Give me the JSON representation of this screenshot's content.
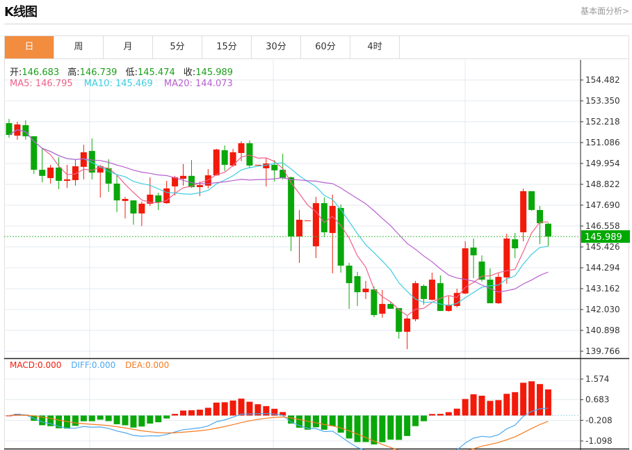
{
  "header": {
    "title": "K线图",
    "link": "基本面分析>"
  },
  "tabs": [
    {
      "label": "日",
      "active": true
    },
    {
      "label": "周"
    },
    {
      "label": "月"
    },
    {
      "label": "5分"
    },
    {
      "label": "15分"
    },
    {
      "label": "30分"
    },
    {
      "label": "60分"
    },
    {
      "label": "4时"
    }
  ],
  "ohlc": {
    "open_label": "开:",
    "open": "146.683",
    "high_label": "高:",
    "high": "146.739",
    "low_label": "低:",
    "low": "145.474",
    "close_label": "收:",
    "close": "145.989"
  },
  "ma": {
    "ma5": "MA5: 146.795",
    "ma10": "MA10: 145.469",
    "ma20": "MA20: 144.073"
  },
  "macd_info": {
    "macd": "MACD:0.000",
    "diff": "DIFF:0.000",
    "dea": "DEA:0.000"
  },
  "colors": {
    "up": "#f21a0a",
    "down": "#09a709",
    "ma5": "#f0608a",
    "ma10": "#3dcde0",
    "ma20": "#b75fcf",
    "diff": "#4aa8f0",
    "dea": "#f57a1f",
    "accent": "#f28c3f"
  },
  "chart_data": {
    "type": "candlestick",
    "price_ticks": [
      "154.482",
      "153.350",
      "152.218",
      "151.086",
      "149.954",
      "148.822",
      "147.690",
      "146.558",
      "145.426",
      "144.294",
      "143.162",
      "142.030",
      "140.898",
      "139.766"
    ],
    "price_range": [
      139.766,
      154.482
    ],
    "last_price": "145.989",
    "macd_ticks": [
      "1.574",
      "0.683",
      "-0.208",
      "-1.098"
    ],
    "macd_range": [
      -1.098,
      1.574
    ],
    "ohlc": [
      [
        152.14,
        152.37,
        151.35,
        151.5
      ],
      [
        151.46,
        152.22,
        151.24,
        152.07
      ],
      [
        152.03,
        152.29,
        151.24,
        151.43
      ],
      [
        151.43,
        151.43,
        149.39,
        149.61
      ],
      [
        149.61,
        150.78,
        148.93,
        149.28
      ],
      [
        149.16,
        149.88,
        148.86,
        149.73
      ],
      [
        149.73,
        150.29,
        148.56,
        149.01
      ],
      [
        149.01,
        149.88,
        148.63,
        149.09
      ],
      [
        149.05,
        150.18,
        148.75,
        149.8
      ],
      [
        149.77,
        150.97,
        149.09,
        150.56
      ],
      [
        150.63,
        151.31,
        149.09,
        149.46
      ],
      [
        149.46,
        149.88,
        148.1,
        149.8
      ],
      [
        149.69,
        150.18,
        148.41,
        148.86
      ],
      [
        148.86,
        149.35,
        147.31,
        147.95
      ],
      [
        147.92,
        148.14,
        146.97,
        148.03
      ],
      [
        147.95,
        147.95,
        146.63,
        147.24
      ],
      [
        147.24,
        147.88,
        146.56,
        147.77
      ],
      [
        147.77,
        149.2,
        147.65,
        148.26
      ],
      [
        148.22,
        148.37,
        147.43,
        147.84
      ],
      [
        147.8,
        149.01,
        147.77,
        148.6
      ],
      [
        148.71,
        149.28,
        148.22,
        149.2
      ],
      [
        149.12,
        149.92,
        148.75,
        149.28
      ],
      [
        149.28,
        150.14,
        148.63,
        148.67
      ],
      [
        148.67,
        148.97,
        148.18,
        148.78
      ],
      [
        148.75,
        149.65,
        148.6,
        149.31
      ],
      [
        149.31,
        150.75,
        149.28,
        150.71
      ],
      [
        150.67,
        150.93,
        149.54,
        149.88
      ],
      [
        149.84,
        150.75,
        149.77,
        150.56
      ],
      [
        150.52,
        151.16,
        150.07,
        151.05
      ],
      [
        151.05,
        151.2,
        149.69,
        149.84
      ],
      [
        149.84,
        149.88,
        149.84,
        149.88
      ],
      [
        149.69,
        150.26,
        148.71,
        149.95
      ],
      [
        149.88,
        150.14,
        148.97,
        149.58
      ],
      [
        149.61,
        150.48,
        149.09,
        149.16
      ],
      [
        149.2,
        149.24,
        145.2,
        145.99
      ],
      [
        145.99,
        147.43,
        144.56,
        146.9
      ],
      [
        146.86,
        146.86,
        146.86,
        146.86
      ],
      [
        145.46,
        148.14,
        144.82,
        147.8
      ],
      [
        147.8,
        148.11,
        145.95,
        146.22
      ],
      [
        146.18,
        148.26,
        143.99,
        147.65
      ],
      [
        147.54,
        147.73,
        144.03,
        144.41
      ],
      [
        144.41,
        144.56,
        142.07,
        143.46
      ],
      [
        143.84,
        144.07,
        142.22,
        142.97
      ],
      [
        142.97,
        143.58,
        142.6,
        143.16
      ],
      [
        143.12,
        143.28,
        141.61,
        141.73
      ],
      [
        141.8,
        143.09,
        141.58,
        142.33
      ],
      [
        142.33,
        142.45,
        142.07,
        142.07
      ],
      [
        142.11,
        142.11,
        140.45,
        140.82
      ],
      [
        140.82,
        141.65,
        139.88,
        141.54
      ],
      [
        141.5,
        143.58,
        141.39,
        143.46
      ],
      [
        143.31,
        143.39,
        142.29,
        142.6
      ],
      [
        142.56,
        144.03,
        142.52,
        143.65
      ],
      [
        143.46,
        143.88,
        141.95,
        141.95
      ],
      [
        141.95,
        142.75,
        141.92,
        142.29
      ],
      [
        142.22,
        143.16,
        142.14,
        142.93
      ],
      [
        142.9,
        145.73,
        142.86,
        145.35
      ],
      [
        145.39,
        145.88,
        143.73,
        144.97
      ],
      [
        144.63,
        144.97,
        143.54,
        143.65
      ],
      [
        143.65,
        144.26,
        142.37,
        142.37
      ],
      [
        142.37,
        143.99,
        142.33,
        143.8
      ],
      [
        143.77,
        146.14,
        143.43,
        145.88
      ],
      [
        145.84,
        146.18,
        144.82,
        145.35
      ],
      [
        146.22,
        148.59,
        145.73,
        148.45
      ],
      [
        148.45,
        148.45,
        147.39,
        147.43
      ],
      [
        147.43,
        147.65,
        145.58,
        146.71
      ],
      [
        146.683,
        146.739,
        145.474,
        145.989
      ]
    ]
  }
}
